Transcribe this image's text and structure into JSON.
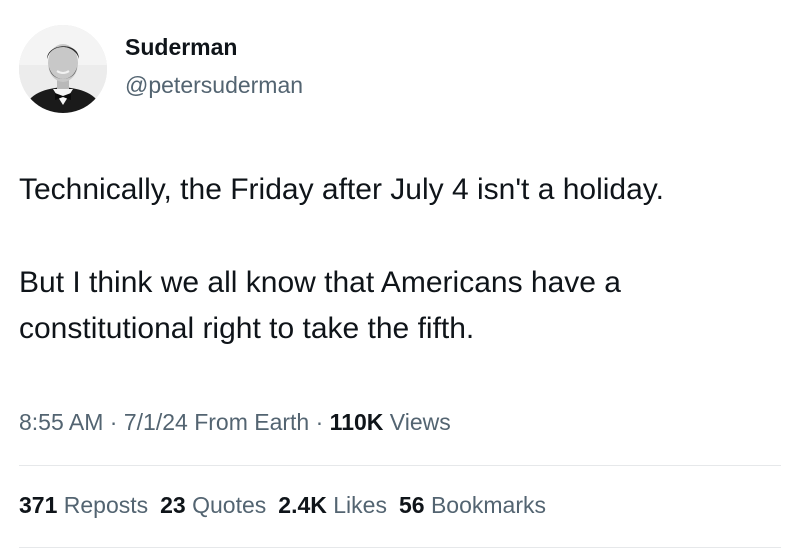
{
  "author": {
    "display_name": "Suderman",
    "handle": "@petersuderman",
    "avatar_icon": "profile-photo"
  },
  "tweet": {
    "lines": [
      "Technically, the Friday after July 4 isn't a holiday.",
      "But I think we all know that Americans have a",
      "constitutional right to take the fifth."
    ]
  },
  "meta": {
    "time": "8:55 AM",
    "sep1": "·",
    "date": "7/1/24",
    "source": "From Earth",
    "sep2": "·",
    "views_count": "110K",
    "views_label": "Views"
  },
  "stats": {
    "reposts": {
      "count": "371",
      "label": "Reposts"
    },
    "quotes": {
      "count": "23",
      "label": "Quotes"
    },
    "likes": {
      "count": "2.4K",
      "label": "Likes"
    },
    "bookmarks": {
      "count": "56",
      "label": "Bookmarks"
    }
  },
  "colors": {
    "text_primary": "#0f1419",
    "text_secondary": "#536471",
    "divider": "#e6e8ea"
  }
}
